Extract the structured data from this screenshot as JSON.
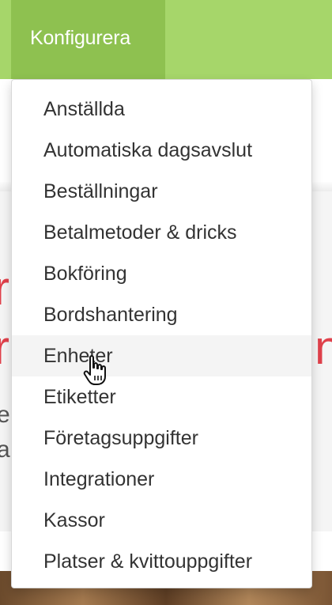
{
  "nav": {
    "active_label": "Konfigurera"
  },
  "menu": {
    "hovered_index": 6,
    "items": [
      {
        "label": "Anställda"
      },
      {
        "label": "Automatiska dagsavslut"
      },
      {
        "label": "Beställningar"
      },
      {
        "label": "Betalmetoder & dricks"
      },
      {
        "label": "Bokföring"
      },
      {
        "label": "Bordshantering"
      },
      {
        "label": "Enheter"
      },
      {
        "label": "Etiketter"
      },
      {
        "label": "Företagsuppgifter"
      },
      {
        "label": "Integrationer"
      },
      {
        "label": "Kassor"
      },
      {
        "label": "Platser & kvittouppgifter"
      }
    ]
  },
  "colors": {
    "nav_bar": "#a6d66a",
    "nav_active": "#8ec150",
    "menu_hover": "#f4f4f4",
    "background_accent": "#e0414b"
  },
  "cursor": {
    "icon": "hand-pointer-icon"
  }
}
